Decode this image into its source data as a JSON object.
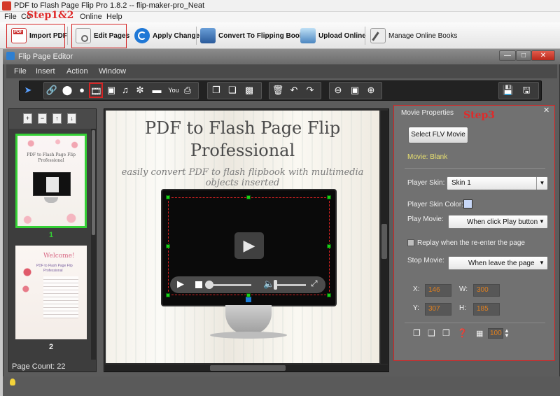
{
  "window": {
    "title": "PDF to Flash Page Flip Pro 1.8.2  -- flip-maker-pro_Neat"
  },
  "menubar": {
    "items": [
      "File",
      "Co",
      "Online",
      "Help"
    ]
  },
  "toolbar": {
    "import_pdf": "Import PDF",
    "edit_pages": "Edit Pages",
    "apply_change": "Apply Change",
    "convert": "Convert To Flipping Book",
    "upload": "Upload Online",
    "manage": "Manage Online Books"
  },
  "annotations": {
    "step12": "Step1&2",
    "step3": "Step3"
  },
  "editor": {
    "title": "Flip Page Editor",
    "menu": [
      "File",
      "Insert",
      "Action",
      "Window"
    ],
    "window_buttons": [
      "—",
      "□",
      "✕"
    ]
  },
  "pages_panel": {
    "thumbnails": [
      {
        "number": "1"
      },
      {
        "number": "2"
      }
    ],
    "page1_text": [
      "PDF to Flash Page Flip",
      "Professional"
    ],
    "page2_text": [
      "Welcome!",
      "PDF to Flash Page Flip",
      "Professional"
    ],
    "page_count": "Page Count: 22"
  },
  "canvas": {
    "title_line1": "PDF to Flash Page Flip",
    "title_line2": "Professional",
    "subtitle": "easily convert PDF to flash flipbook with multimedia objects inserted"
  },
  "properties": {
    "title": "Movie Properties",
    "select_button": "Select FLV Movie",
    "movie_status": "Movie: Blank",
    "player_skin_label": "Player Skin:",
    "player_skin_value": "Skin 1",
    "skin_color_label": "Player Skin Color:",
    "play_movie_label": "Play Movie:",
    "play_movie_value": "When click Play button",
    "replay_label": "Replay when the re-enter the page",
    "stop_movie_label": "Stop Movie:",
    "stop_movie_value": "When leave the page",
    "x_label": "X:",
    "x_value": "146",
    "w_label": "W:",
    "w_value": "300",
    "y_label": "Y:",
    "y_value": "307",
    "h_label": "H:",
    "h_value": "185",
    "opacity_value": "100",
    "skin_color": "#c8d8f8"
  },
  "colors": {
    "annotation": "#d42424",
    "selection_handle": "#19d219",
    "value_text": "#e08020"
  }
}
